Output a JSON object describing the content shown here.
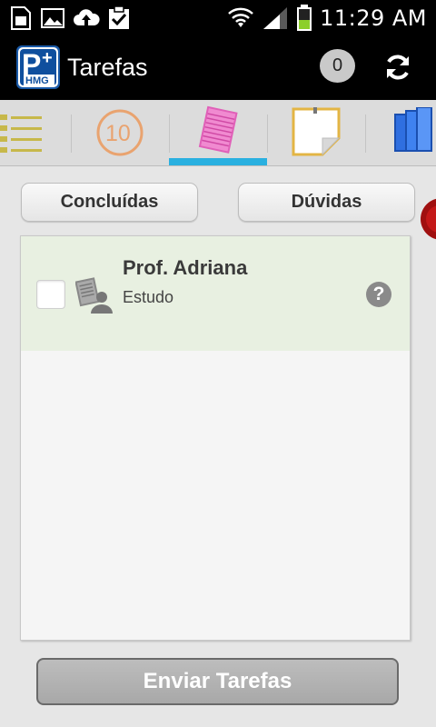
{
  "status_bar": {
    "time": "11:29 AM",
    "icons": [
      "sim-icon",
      "image-icon",
      "cloud-upload-icon",
      "clipboard-check-icon",
      "wifi-icon",
      "signal-icon",
      "battery-icon"
    ]
  },
  "action_bar": {
    "logo_icon": "phmg-logo-icon",
    "title": "Tarefas",
    "count": "0",
    "refresh_icon": "refresh-icon"
  },
  "tabs": [
    {
      "icon": "checklist-icon",
      "selected": false
    },
    {
      "icon": "grade-ten-icon",
      "glyph": "10",
      "selected": false
    },
    {
      "icon": "notepad-icon",
      "selected": true
    },
    {
      "icon": "sticky-note-icon",
      "selected": false
    },
    {
      "icon": "books-icon",
      "selected": false
    }
  ],
  "buttons": {
    "done": "Concluídas",
    "doubts": "Dúvidas",
    "send": "Enviar Tarefas"
  },
  "tasks": [
    {
      "title": "Prof. Adriana",
      "subtitle": "Estudo",
      "checked": false,
      "icon": "teacher-document-icon",
      "action": "?"
    }
  ],
  "colors": {
    "accent": "#2ab0e0",
    "item_background": "#e8f0e1",
    "side_tab": "#c41818"
  }
}
